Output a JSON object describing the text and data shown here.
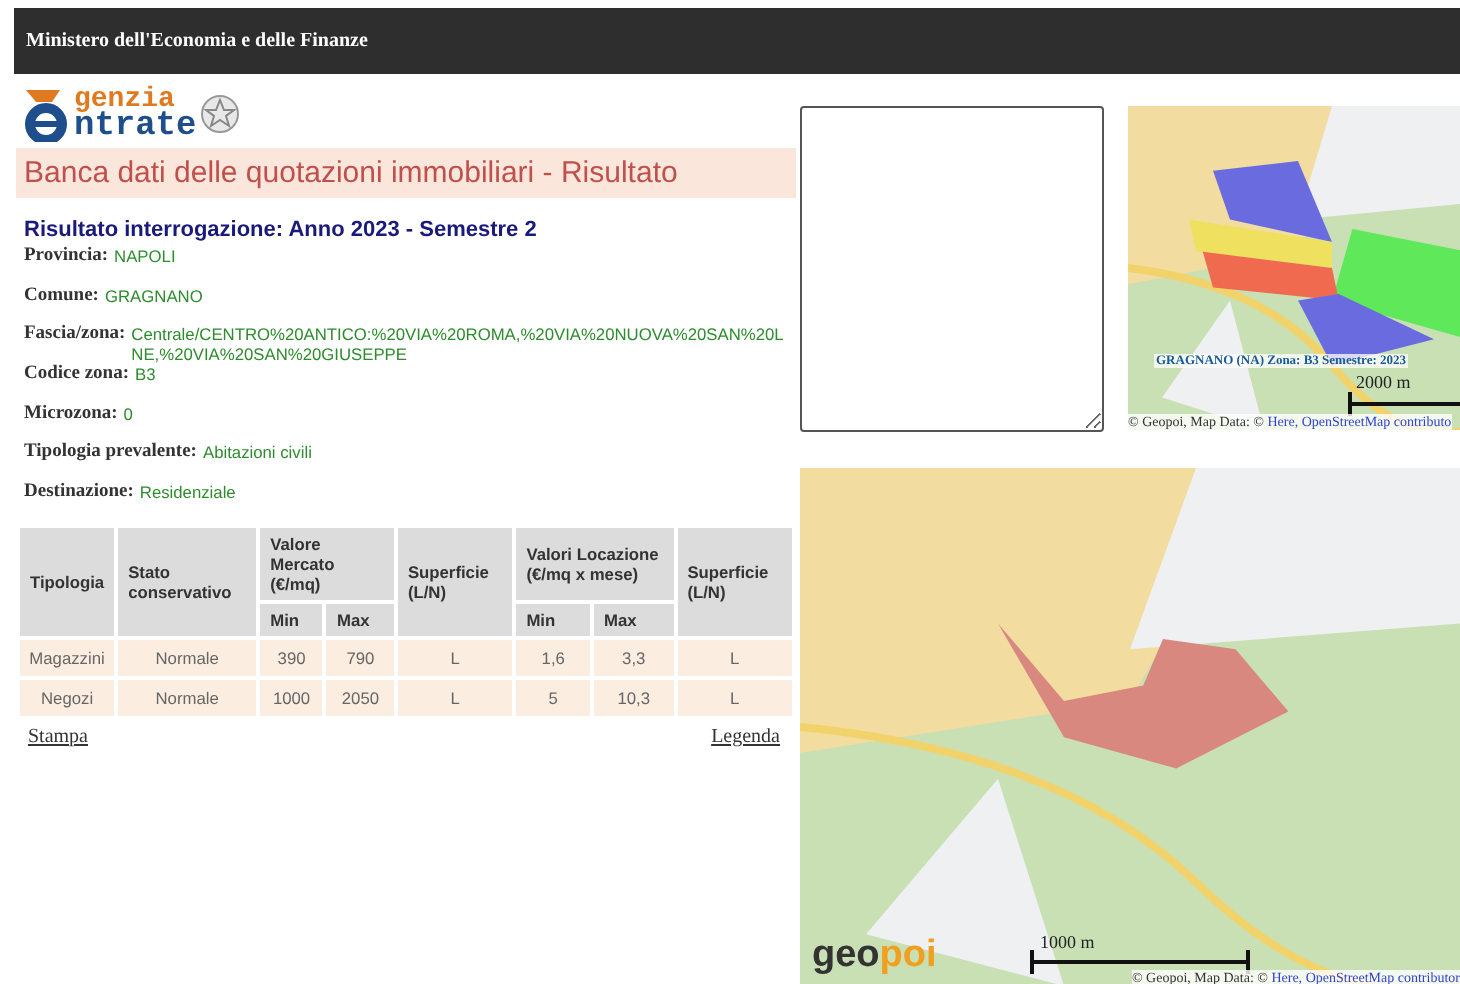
{
  "header": {
    "title": "Ministero dell'Economia e delle Finanze"
  },
  "logo": {
    "lines": [
      "genzia",
      "ntrate"
    ]
  },
  "page_title": "Banca dati delle quotazioni immobiliari - Risultato",
  "result_heading": "Risultato interrogazione: Anno 2023 - Semestre 2",
  "fields": [
    {
      "label": "Provincia:",
      "value_lines": [
        "NAPOLI"
      ]
    },
    {
      "label": "Comune:",
      "value_lines": [
        "GRAGNANO"
      ]
    },
    {
      "label": "Fascia/zona:",
      "value_lines": [
        "Centrale/CENTRO%20ANTICO:%20VIA%20ROMA,%20VIA%20NUOVA%20SAN%20L",
        "NE,%20VIA%20SAN%20GIUSEPPE"
      ]
    },
    {
      "label": "Codice zona:",
      "value_lines": [
        "B3"
      ]
    },
    {
      "label": "Microzona:",
      "value_lines": [
        "0"
      ]
    },
    {
      "label": "Tipologia prevalente:",
      "value_lines": [
        "Abitazioni civili"
      ]
    },
    {
      "label": "Destinazione:",
      "value_lines": [
        "Residenziale"
      ]
    }
  ],
  "table": {
    "columns": [
      {
        "label": "Tipologia"
      },
      {
        "label": "Stato conservativo"
      },
      {
        "label": "Valore Mercato (€/mq)",
        "colspan": 2,
        "sub": [
          "Min",
          "Max"
        ]
      },
      {
        "label": "Superficie (L/N)"
      },
      {
        "label": "Valori Locazione (€/mq x mese)",
        "colspan": 2,
        "sub": [
          "Min",
          "Max"
        ]
      },
      {
        "label": "Superficie (L/N)"
      }
    ],
    "rows": [
      [
        "Magazzini",
        "Normale",
        "390",
        "790",
        "L",
        "1,6",
        "3,3",
        "L"
      ],
      [
        "Negozi",
        "Normale",
        "1000",
        "2050",
        "L",
        "5",
        "10,3",
        "L"
      ]
    ]
  },
  "links": [
    "Stampa",
    "Legenda"
  ],
  "small_map": {
    "caption": "GRAGNANO (NA) Zona: B3 Semestre: 2023",
    "scale": "2000 m",
    "attribution": "© Geopoi, Map Data: ©",
    "attribution_links": [
      "Here,",
      "OpenStreetMap contributo"
    ]
  },
  "big_map": {
    "brand": [
      "geo",
      "poi"
    ],
    "scale": "1000 m",
    "attribution": "© Geopoi, Map Data: ©",
    "attribution_links": [
      "Here,",
      "OpenStreetMap contributor"
    ]
  }
}
